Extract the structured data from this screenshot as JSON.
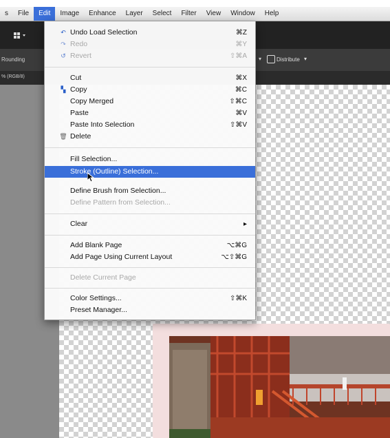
{
  "menubar": {
    "items": [
      {
        "label": "s"
      },
      {
        "label": "File"
      },
      {
        "label": "Edit"
      },
      {
        "label": "Image"
      },
      {
        "label": "Enhance"
      },
      {
        "label": "Layer"
      },
      {
        "label": "Select"
      },
      {
        "label": "Filter"
      },
      {
        "label": "View"
      },
      {
        "label": "Window"
      },
      {
        "label": "Help"
      }
    ]
  },
  "toolbar": {
    "left_label": "Rounding",
    "distribute_label": "Distribute",
    "tab_label": "% (RGB/8)"
  },
  "edit_menu": {
    "undo": {
      "label": "Undo Load Selection",
      "shortcut": "⌘Z"
    },
    "redo": {
      "label": "Redo",
      "shortcut": "⌘Y"
    },
    "revert": {
      "label": "Revert",
      "shortcut": "⇧⌘A"
    },
    "cut": {
      "label": "Cut",
      "shortcut": "⌘X"
    },
    "copy": {
      "label": "Copy",
      "shortcut": "⌘C"
    },
    "copy_merged": {
      "label": "Copy Merged",
      "shortcut": "⇧⌘C"
    },
    "paste": {
      "label": "Paste",
      "shortcut": "⌘V"
    },
    "paste_into": {
      "label": "Paste Into Selection",
      "shortcut": "⇧⌘V"
    },
    "delete": {
      "label": "Delete"
    },
    "fill_selection": {
      "label": "Fill Selection..."
    },
    "stroke_selection": {
      "label": "Stroke (Outline) Selection..."
    },
    "define_brush": {
      "label": "Define Brush from Selection..."
    },
    "define_pattern": {
      "label": "Define Pattern from Selection..."
    },
    "clear": {
      "label": "Clear",
      "arrow": "▸"
    },
    "add_blank_page": {
      "label": "Add Blank Page",
      "shortcut": "⌥⌘G"
    },
    "add_page_layout": {
      "label": "Add Page Using Current Layout",
      "shortcut": "⌥⇧⌘G"
    },
    "delete_current_page": {
      "label": "Delete Current Page"
    },
    "color_settings": {
      "label": "Color Settings...",
      "shortcut": "⇧⌘K"
    },
    "preset_manager": {
      "label": "Preset Manager..."
    }
  },
  "colors": {
    "highlight": "#3a6fd9",
    "app_dark": "#222222"
  }
}
